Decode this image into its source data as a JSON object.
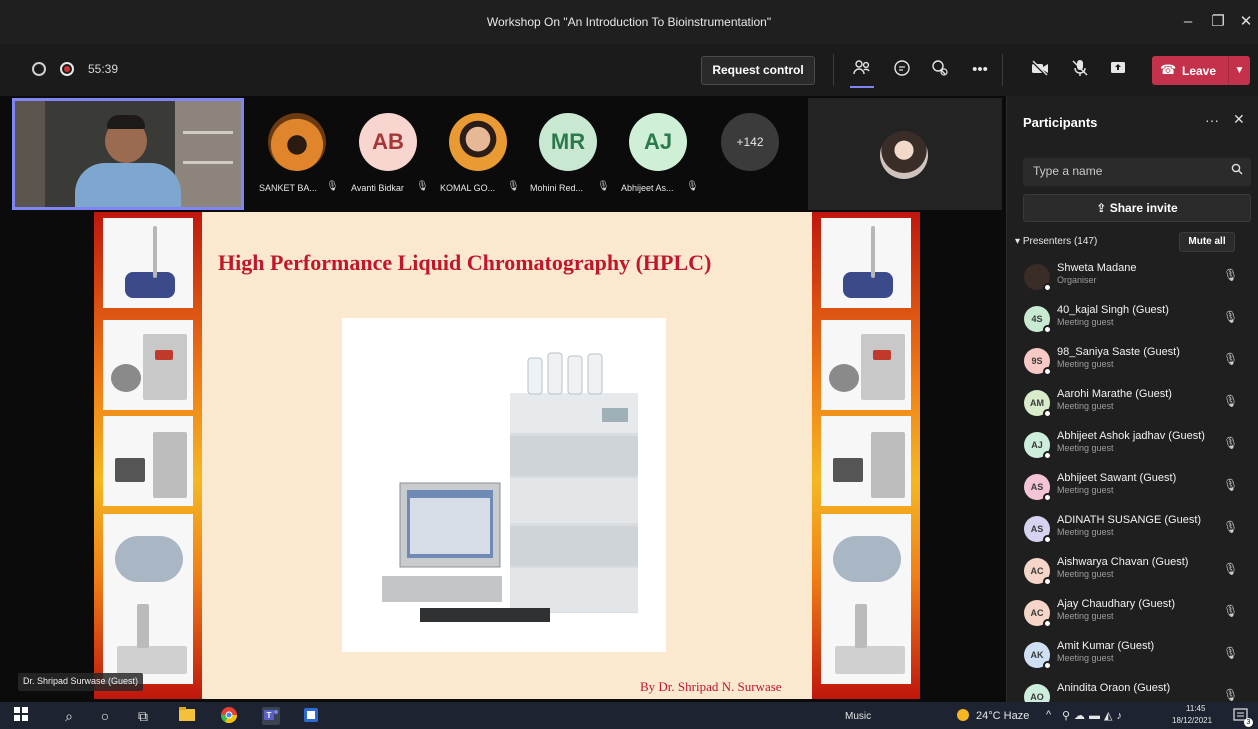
{
  "window": {
    "title": "Workshop On \"An Introduction To Bioinstrumentation\""
  },
  "toolbar": {
    "timer": "55:39",
    "request_control_label": "Request control",
    "leave_label": "Leave"
  },
  "strip": {
    "participants": [
      {
        "name": "SANKET BA...",
        "initials": "",
        "color": "#c97a2a"
      },
      {
        "name": "Avanti Bidkar",
        "initials": "AB",
        "color": "#f8d5cf"
      },
      {
        "name": "KOMAL GO...",
        "initials": "",
        "color": "#d8b59a"
      },
      {
        "name": "Mohini Red...",
        "initials": "MR",
        "color": "#c9e8d2"
      },
      {
        "name": "Abhijeet As...",
        "initials": "AJ",
        "color": "#cfefd6"
      }
    ],
    "overflow_label": "+142"
  },
  "slide": {
    "title": "High Performance Liquid Chromatography (HPLC)",
    "author": "By  Dr. Shripad N. Surwase"
  },
  "presenter_label": "Dr. Shripad Surwase (Guest)",
  "panel": {
    "title": "Participants",
    "search_placeholder": "Type a name",
    "share_invite_label": "Share invite",
    "presenters_header": "Presenters (147)",
    "mute_all_label": "Mute all",
    "participants": [
      {
        "name": "Shweta Madane",
        "role": "Organiser",
        "initials": "",
        "color": "#3a2d27"
      },
      {
        "name": "40_kajal Singh (Guest)",
        "role": "Meeting guest",
        "initials": "4S",
        "color": "#c8ead2"
      },
      {
        "name": "98_Saniya Saste (Guest)",
        "role": "Meeting guest",
        "initials": "9S",
        "color": "#f6c9c4"
      },
      {
        "name": "Aarohi Marathe (Guest)",
        "role": "Meeting guest",
        "initials": "AM",
        "color": "#d8eccb"
      },
      {
        "name": "Abhijeet Ashok jadhav (Guest)",
        "role": "Meeting guest",
        "initials": "AJ",
        "color": "#cdeedd"
      },
      {
        "name": "Abhijeet Sawant (Guest)",
        "role": "Meeting guest",
        "initials": "AS",
        "color": "#f3c4d8"
      },
      {
        "name": "ADINATH SUSANGE (Guest)",
        "role": "Meeting guest",
        "initials": "AS",
        "color": "#d6d3f1"
      },
      {
        "name": "Aishwarya Chavan (Guest)",
        "role": "Meeting guest",
        "initials": "AC",
        "color": "#f4d5c8"
      },
      {
        "name": "Ajay Chaudhary (Guest)",
        "role": "Meeting guest",
        "initials": "AC",
        "color": "#f4d5c8"
      },
      {
        "name": "Amit Kumar (Guest)",
        "role": "Meeting guest",
        "initials": "AK",
        "color": "#cfe0f5"
      },
      {
        "name": "Anindita Oraon (Guest)",
        "role": "",
        "initials": "AO",
        "color": "#cdeedd"
      }
    ]
  },
  "taskbar": {
    "music_label": "Music",
    "weather": "24°C  Haze",
    "time": "11:45",
    "date": "18/12/2021",
    "notification_count": "3"
  },
  "colors": {
    "accent": "#7f85f5",
    "leave": "#c4314b",
    "slide_title": "#c0172a"
  }
}
